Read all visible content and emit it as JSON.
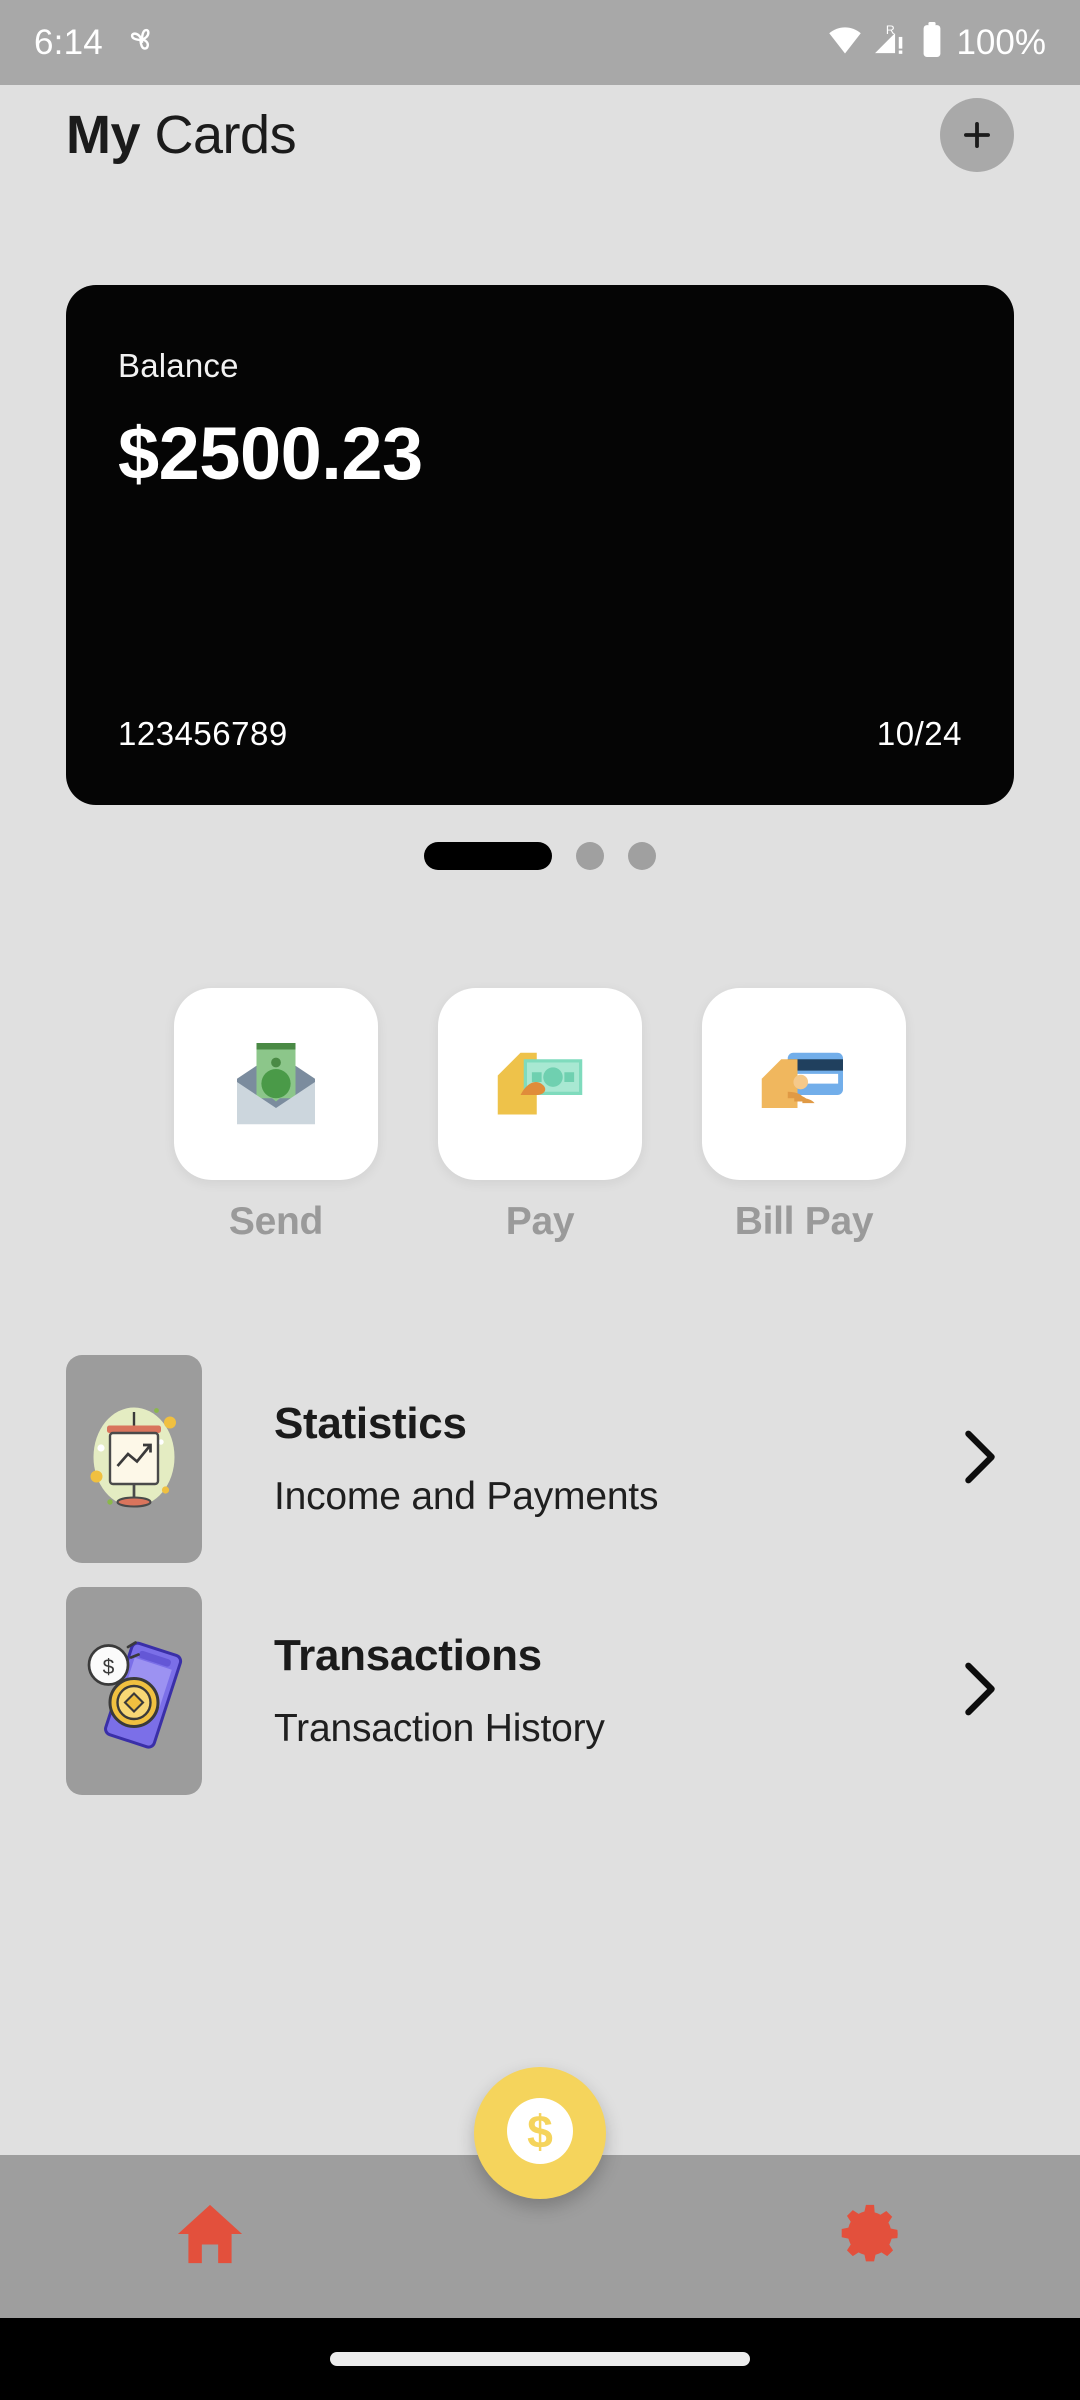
{
  "status_bar": {
    "time": "6:14",
    "battery_percent": "100%",
    "icons": [
      "pinwheel-icon",
      "wifi-icon",
      "cellular-signal-roaming-icon",
      "battery-icon"
    ]
  },
  "header": {
    "title_bold": "My",
    "title_light": " Cards",
    "add_button": "add-card-button"
  },
  "card": {
    "balance_label": "Balance",
    "balance_amount": "$2500.23",
    "card_number": "123456789",
    "expiry": "10/24",
    "background_color": "#050505"
  },
  "carousel": {
    "total_pages": 3,
    "active_index": 0,
    "active_color": "#000000",
    "inactive_color": "#a0a0a0"
  },
  "actions": [
    {
      "label": "Send",
      "icon": "money-envelope-icon"
    },
    {
      "label": "Pay",
      "icon": "hand-holding-cash-icon"
    },
    {
      "label": "Bill Pay",
      "icon": "hand-holding-credit-card-icon"
    }
  ],
  "menu_rows": [
    {
      "title": "Statistics",
      "subtitle": "Income and Payments",
      "icon": "presentation-chart-icon",
      "chevron": "chevron-right-icon"
    },
    {
      "title": "Transactions",
      "subtitle": "Transaction History",
      "icon": "phone-coins-icon",
      "chevron": "chevron-right-icon"
    }
  ],
  "bottom_nav": {
    "home": "home-icon",
    "fab": "dollar-coin-icon",
    "settings": "gear-icon",
    "accent_color": "#e3503c",
    "fab_color": "#f5d45c"
  }
}
